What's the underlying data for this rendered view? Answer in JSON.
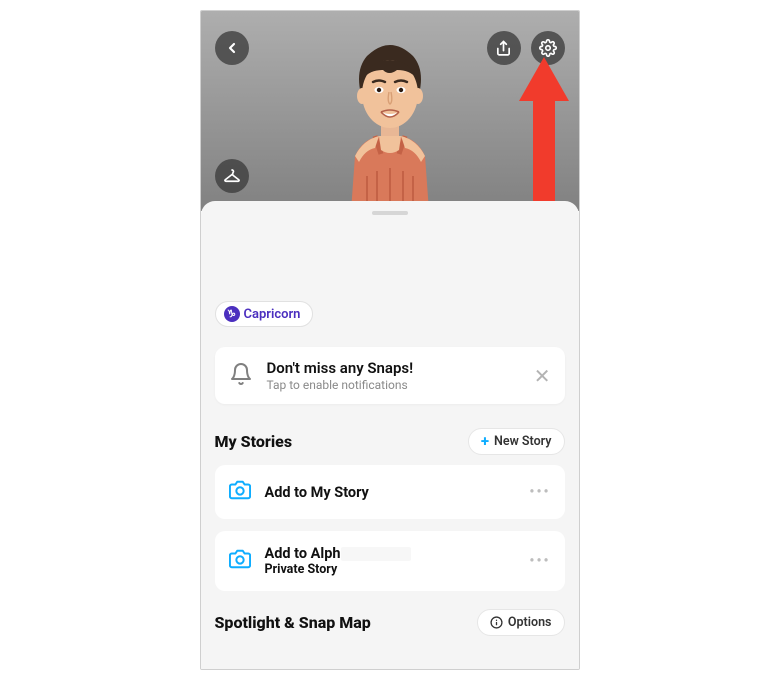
{
  "header": {
    "icons": {
      "back": "back-chevron",
      "share": "share",
      "settings": "gear",
      "outfit": "hanger"
    }
  },
  "annotation": {
    "arrow_color": "#F13B2C",
    "points_to": "settings-button"
  },
  "badge": {
    "label": "Capricorn",
    "color": "#4b2fbf"
  },
  "notification": {
    "title": "Don't miss any Snaps!",
    "subtitle": "Tap to enable notifications"
  },
  "stories": {
    "heading": "My Stories",
    "new_button": "New Story",
    "items": [
      {
        "line1": "Add to My Story",
        "line2": ""
      },
      {
        "line1": "Add to Alpha",
        "line2": "Private Story",
        "line1_display": "Add to Alph"
      }
    ]
  },
  "spotlight": {
    "heading": "Spotlight & Snap Map",
    "options_button": "Options"
  },
  "colors": {
    "accent_blue": "#0EADFF",
    "badge_purple": "#4b2fbf"
  }
}
